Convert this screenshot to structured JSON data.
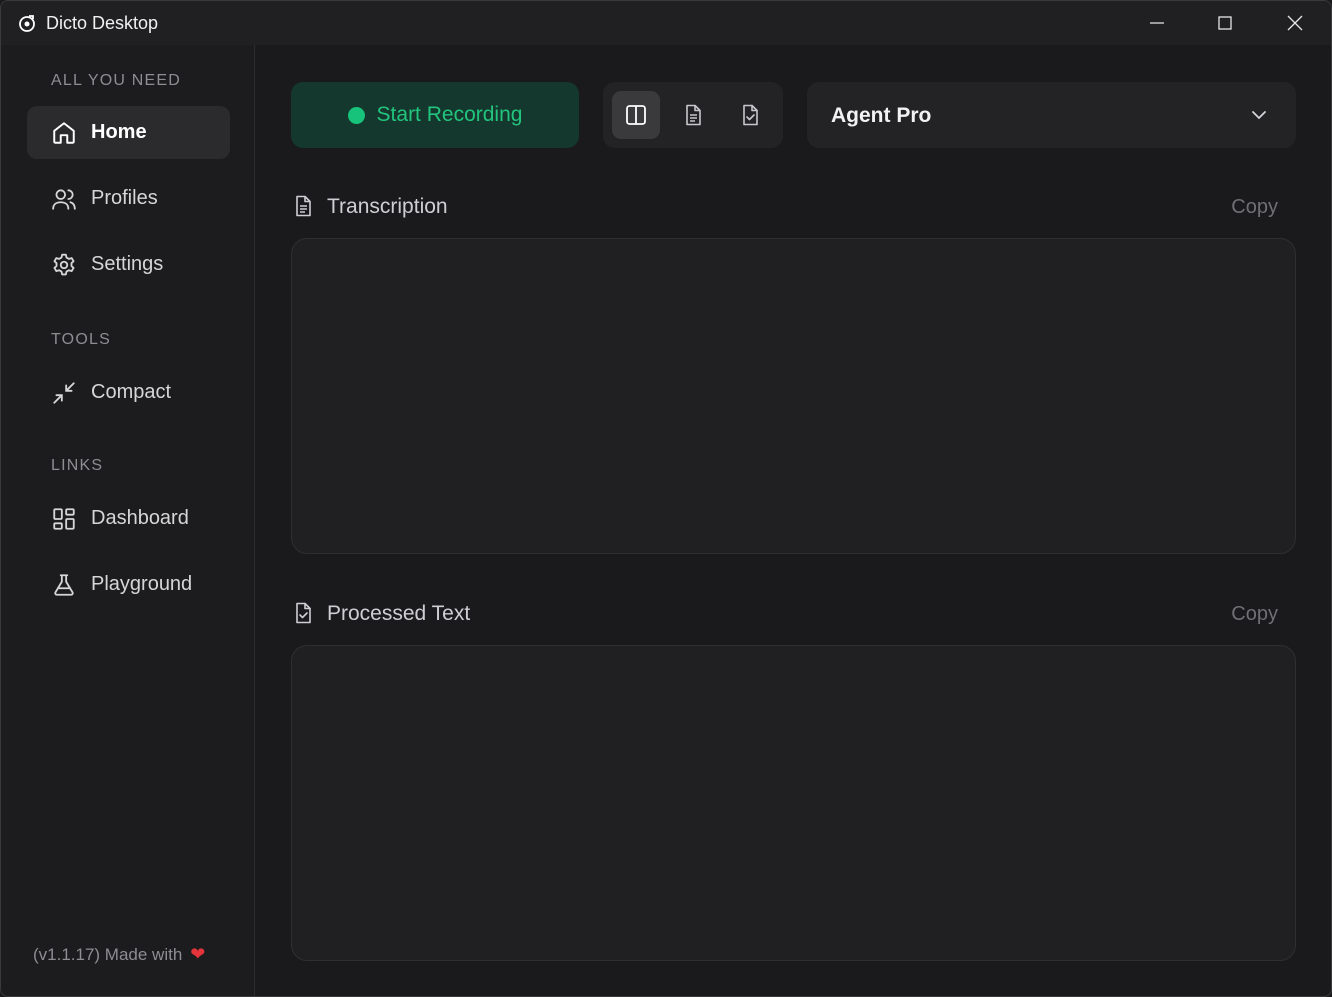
{
  "window": {
    "title": "Dicto Desktop"
  },
  "sidebar": {
    "sections": [
      {
        "label": "ALL YOU NEED"
      },
      {
        "label": "TOOLS"
      },
      {
        "label": "LINKS"
      }
    ],
    "items": [
      {
        "label": "Home",
        "icon": "home-icon",
        "active": true
      },
      {
        "label": "Profiles",
        "icon": "users-icon"
      },
      {
        "label": "Settings",
        "icon": "gear-icon"
      },
      {
        "label": "Compact",
        "icon": "minimize-icon"
      },
      {
        "label": "Dashboard",
        "icon": "dashboard-icon"
      },
      {
        "label": "Playground",
        "icon": "flask-icon"
      }
    ],
    "footer": "(v1.1.17) Made with"
  },
  "toolbar": {
    "record_label": "Start Recording",
    "profile_value": "Agent Pro"
  },
  "panels": {
    "transcription": {
      "title": "Transcription",
      "copy": "Copy"
    },
    "processed": {
      "title": "Processed Text",
      "copy": "Copy"
    }
  },
  "colors": {
    "accent_green": "#22c47e",
    "record_bg": "#14382d",
    "heart": "#e5343a"
  }
}
